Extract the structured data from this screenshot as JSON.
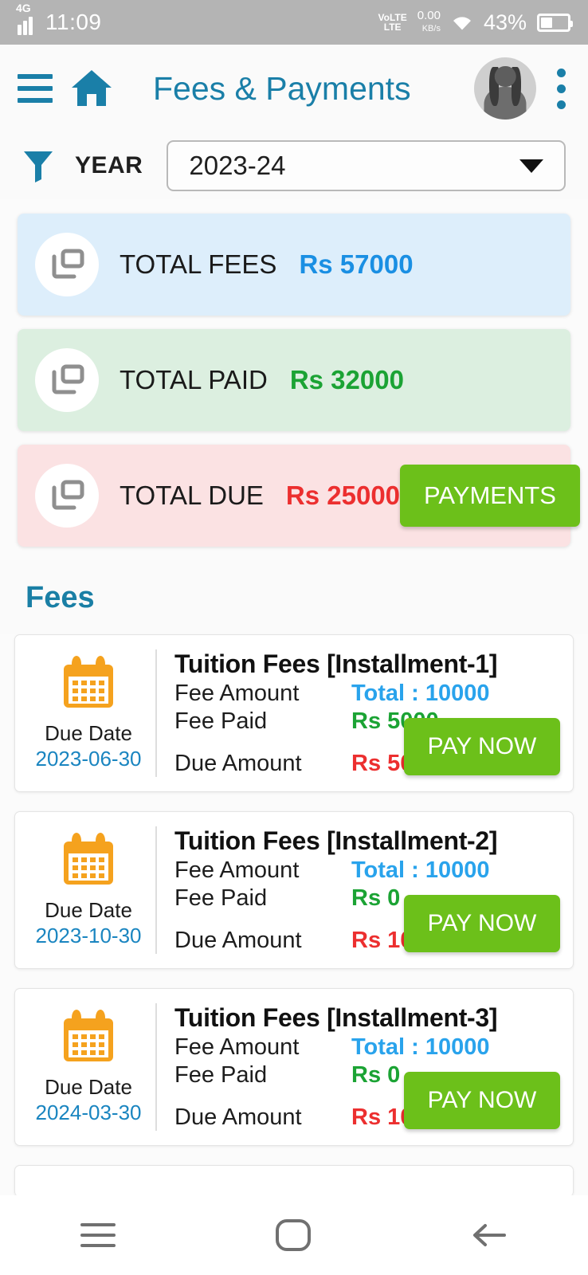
{
  "statusbar": {
    "network": "4G",
    "time": "11:09",
    "volte_line1": "VoLTE",
    "volte_line2": "LTE",
    "data_rate": "0.00",
    "data_unit": "KB/s",
    "battery_percent": "43%",
    "icons": {
      "signal": "signal-bars-icon",
      "wifi": "wifi-icon",
      "battery": "battery-icon"
    }
  },
  "appbar": {
    "menu_icon": "hamburger-menu-icon",
    "home_icon": "home-icon",
    "title": "Fees & Payments",
    "avatar_icon": "user-avatar",
    "overflow_icon": "more-vertical-icon"
  },
  "filter": {
    "filter_icon": "funnel-filter-icon",
    "label": "YEAR",
    "selected_year": "2023-24",
    "caret_icon": "chevron-down-icon"
  },
  "summary": [
    {
      "icon": "copy-layers-icon",
      "label": "TOTAL FEES",
      "value": "Rs 57000",
      "value_color": "#1a8fe3",
      "bg": "#ddeefb",
      "tone": "blue"
    },
    {
      "icon": "copy-layers-icon",
      "label": "TOTAL PAID",
      "value": "Rs 32000",
      "value_color": "#1ba334",
      "bg": "#dcefe0",
      "tone": "green"
    },
    {
      "icon": "copy-layers-icon",
      "label": "TOTAL DUE",
      "value": "Rs 25000",
      "value_color": "#ec2f2f",
      "bg": "#fbe2e3",
      "tone": "pink",
      "action_label": "PAYMENTS"
    }
  ],
  "section": {
    "title": "Fees"
  },
  "fee_labels": {
    "due_date": "Due Date",
    "fee_amount": "Fee Amount",
    "fee_paid": "Fee Paid",
    "due_amount": "Due Amount",
    "pay_now": "PAY NOW",
    "calendar_icon": "calendar-icon"
  },
  "fees": [
    {
      "title": "Tuition Fees [Installment-1]",
      "due_date": "2023-06-30",
      "fee_amount": "Total : 10000",
      "fee_paid": "Rs 5000",
      "due_amount": "Rs 5000",
      "pay_now": "PAY NOW"
    },
    {
      "title": "Tuition Fees [Installment-2]",
      "due_date": "2023-10-30",
      "fee_amount": "Total : 10000",
      "fee_paid": "Rs 0",
      "due_amount": "Rs 10000",
      "pay_now": "PAY NOW"
    },
    {
      "title": "Tuition Fees [Installment-3]",
      "due_date": "2024-03-30",
      "fee_amount": "Total : 10000",
      "fee_paid": "Rs 0",
      "due_amount": "Rs 10000",
      "pay_now": "PAY NOW"
    }
  ],
  "navbar": {
    "recents_icon": "recents-icon",
    "home_icon": "home-circle-icon",
    "back_icon": "back-arrow-icon"
  },
  "colors": {
    "accent_teal": "#1a7fa8",
    "action_green": "#6cc01a",
    "value_blue": "#1a8fe3",
    "value_green": "#1ba334",
    "value_red": "#ec2f2f",
    "calendar_orange": "#f5a21e"
  }
}
